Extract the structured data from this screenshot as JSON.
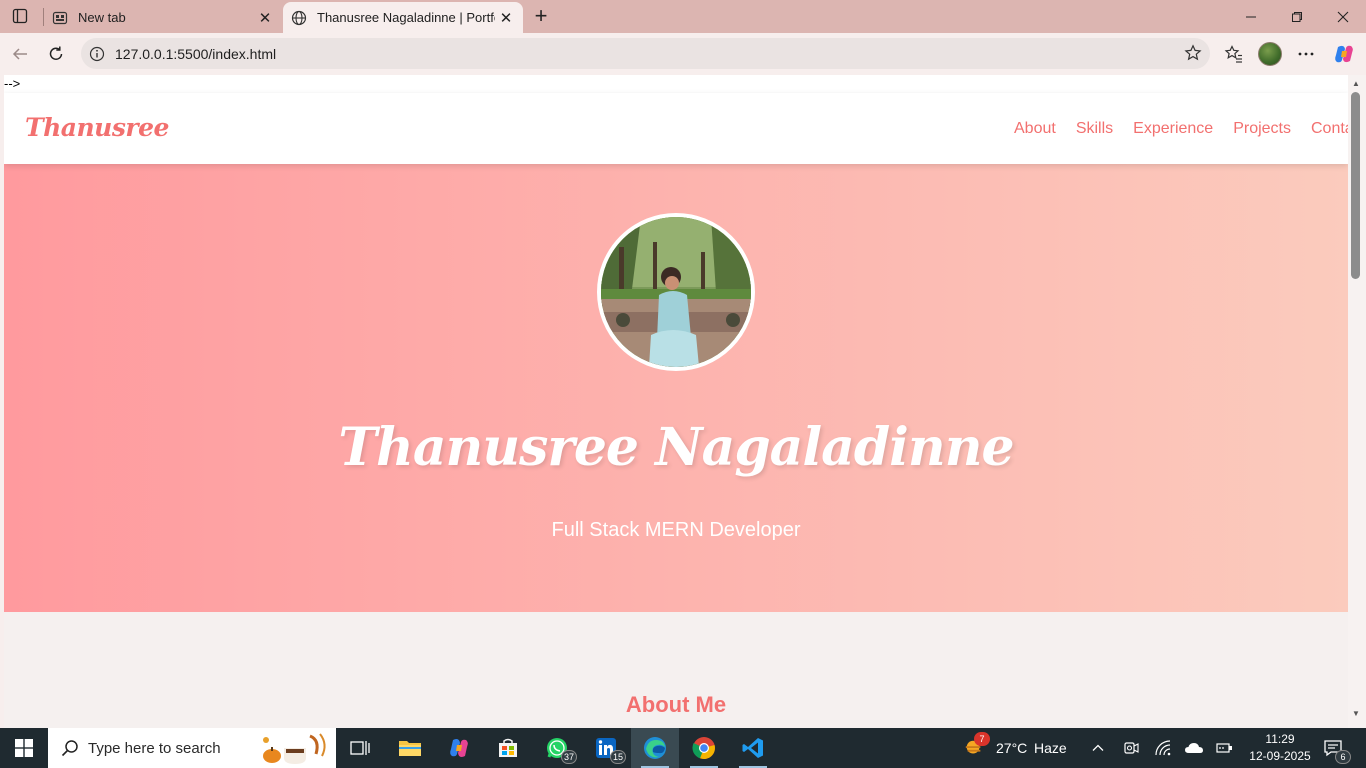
{
  "browser": {
    "tabs": [
      {
        "title": "New tab",
        "active": false
      },
      {
        "title": "Thanusree Nagaladinne | Portfolio",
        "active": true
      }
    ],
    "address": "127.0.0.1:5500/index.html"
  },
  "page": {
    "stray_text": "-->",
    "nav": {
      "logo": "Thanusree",
      "links": [
        "About",
        "Skills",
        "Experience",
        "Projects",
        "Contact"
      ]
    },
    "hero": {
      "name": "Thanusree Nagaladinne",
      "role": "Full Stack MERN Developer"
    },
    "about_title": "About Me"
  },
  "taskbar": {
    "search_placeholder": "Type here to search",
    "whatsapp_badge": "37",
    "linkedin_badge": "15",
    "weather_badge": "7",
    "temperature": "27°C",
    "weather": "Haze",
    "time": "11:29",
    "date": "12-09-2025",
    "notifications": "6"
  },
  "colors": {
    "accent": "#f2706f",
    "hero_gradient_start": "#ff9a9e",
    "hero_gradient_end": "#fbcbbd"
  }
}
